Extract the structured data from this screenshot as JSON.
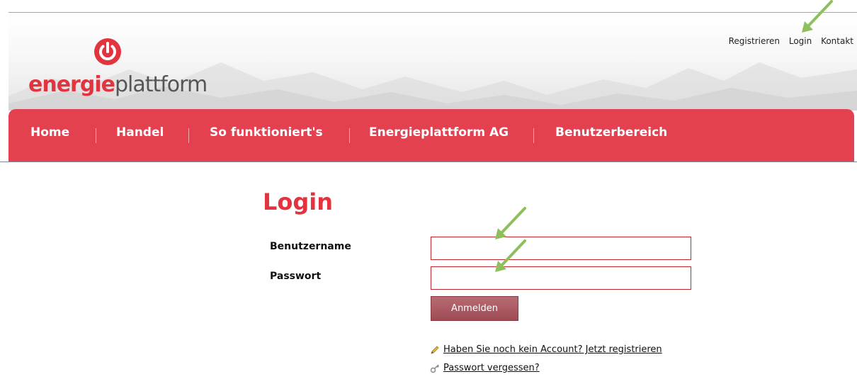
{
  "logo": {
    "text_red": "energie",
    "text_gray": "plattform",
    "icon": "power-icon"
  },
  "top_links": [
    "Registrieren",
    "Login",
    "Kontakt"
  ],
  "nav": [
    "Home",
    "Handel",
    "So funktioniert's",
    "Energieplattform AG",
    "Benutzerbereich"
  ],
  "login": {
    "title": "Login",
    "username_label": "Benutzername",
    "username_value": "",
    "password_label": "Passwort",
    "password_value": "",
    "submit_label": "Anmelden"
  },
  "links": {
    "register": {
      "icon": "pencil-icon",
      "text": "Haben Sie noch kein Account? Jetzt registrieren"
    },
    "forgot": {
      "icon": "key-icon",
      "text": "Passwort vergessen?"
    }
  },
  "colors": {
    "brand_red": "#e2343f",
    "nav_red": "#e34050",
    "button": "#a85560",
    "annotation_arrow": "#8dc05a"
  }
}
